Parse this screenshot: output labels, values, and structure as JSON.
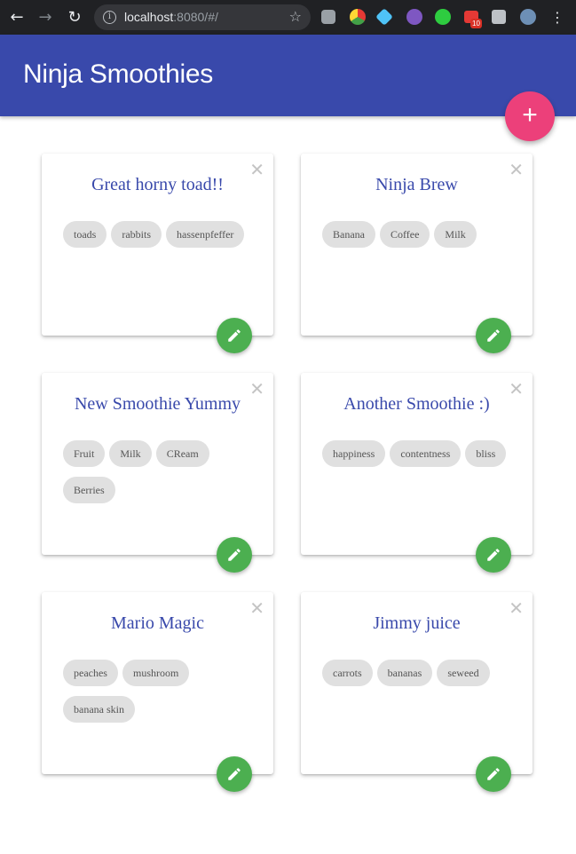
{
  "browser": {
    "url_host": "localhost",
    "url_rest": ":8080/#/",
    "extension_badge": "10"
  },
  "app": {
    "title": "Ninja Smoothies",
    "add_button": "+"
  },
  "smoothies": [
    {
      "title": "Great horny toad!!",
      "ingredients": [
        "toads",
        "rabbits",
        "hassenpfeffer"
      ]
    },
    {
      "title": "Ninja Brew",
      "ingredients": [
        "Banana",
        "Coffee",
        "Milk"
      ]
    },
    {
      "title": "New Smoothie Yummy",
      "ingredients": [
        "Fruit",
        "Milk",
        "CReam",
        "Berries"
      ]
    },
    {
      "title": "Another Smoothie :)",
      "ingredients": [
        "happiness",
        "contentness",
        "bliss"
      ]
    },
    {
      "title": "Mario Magic",
      "ingredients": [
        "peaches",
        "mushroom",
        "banana skin"
      ]
    },
    {
      "title": "Jimmy juice",
      "ingredients": [
        "carrots",
        "bananas",
        "seweed"
      ]
    }
  ],
  "colors": {
    "header": "#3949ab",
    "fab": "#ec407a",
    "edit": "#4caf50",
    "chip": "#e0e0e0"
  }
}
